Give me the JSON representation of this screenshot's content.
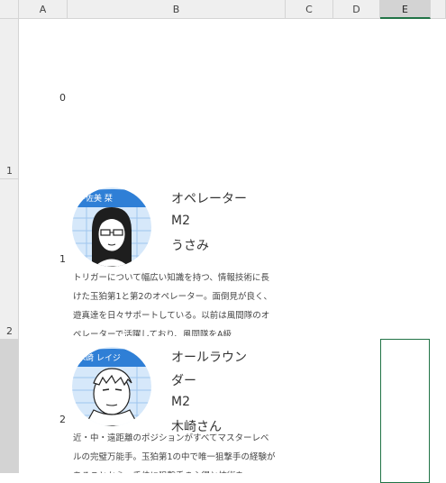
{
  "columns": [
    "A",
    "B",
    "C",
    "D",
    "E"
  ],
  "selected_column": "E",
  "row_headers": [
    "1",
    "2"
  ],
  "cell_numbers": [
    "0",
    "1",
    "2"
  ],
  "characters": [
    {
      "banner_text": "宇佐美 栞",
      "role": "オペレーター",
      "rank": "M2",
      "name": "うさみ",
      "description": "トリガーについて幅広い知識を持つ、情報技術に長けた玉狛第1と第2のオペレーター。面倒見が良く、遊真達を日々サポートしている。以前は風間隊のオペレーターで活躍しており、風間隊をA級"
    },
    {
      "banner_text": "木崎 レイジ",
      "role_line1": "オールラウン",
      "role_line2": "ダー",
      "rank": "M2",
      "name": "木崎さん",
      "description": "近・中・遠距離のポジションがすべてマスターレベルの完璧万能手。玉狛第1の中で唯一狙撃手の経験があることから、千佳に狙撃手の心得と技術を"
    }
  ],
  "colors": {
    "header_bg": "#efefef",
    "selection_green": "#217346",
    "banner_blue": "#2f7fd6"
  }
}
